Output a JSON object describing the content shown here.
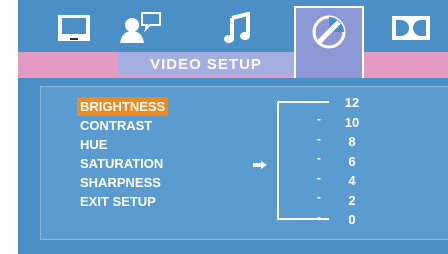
{
  "tabs": [
    {
      "name": "general-setup",
      "icon": "monitor-icon",
      "active": false
    },
    {
      "name": "speaker-setup",
      "icon": "user-speech-icon",
      "active": false
    },
    {
      "name": "audio-setup",
      "icon": "music-note-icon",
      "active": false
    },
    {
      "name": "video-setup",
      "icon": "video-disc-icon",
      "active": true
    },
    {
      "name": "dolby-setup",
      "icon": "dolby-icon",
      "active": false
    }
  ],
  "title": "VIDEO SETUP",
  "menu": {
    "items": [
      {
        "label": "BRIGHTNESS",
        "selected": true
      },
      {
        "label": "CONTRAST",
        "selected": false
      },
      {
        "label": "HUE",
        "selected": false
      },
      {
        "label": "SATURATION",
        "selected": false
      },
      {
        "label": "SHARPNESS",
        "selected": false
      },
      {
        "label": "EXIT SETUP",
        "selected": false
      }
    ]
  },
  "level": {
    "values": [
      "12",
      "10",
      "8",
      "6",
      "4",
      "2",
      "0"
    ],
    "current_index": 3
  },
  "colors": {
    "background": "#4a8fc6",
    "title_bar": "#e59ac4",
    "selected": "#ef8a1e",
    "text": "#ffffff"
  }
}
